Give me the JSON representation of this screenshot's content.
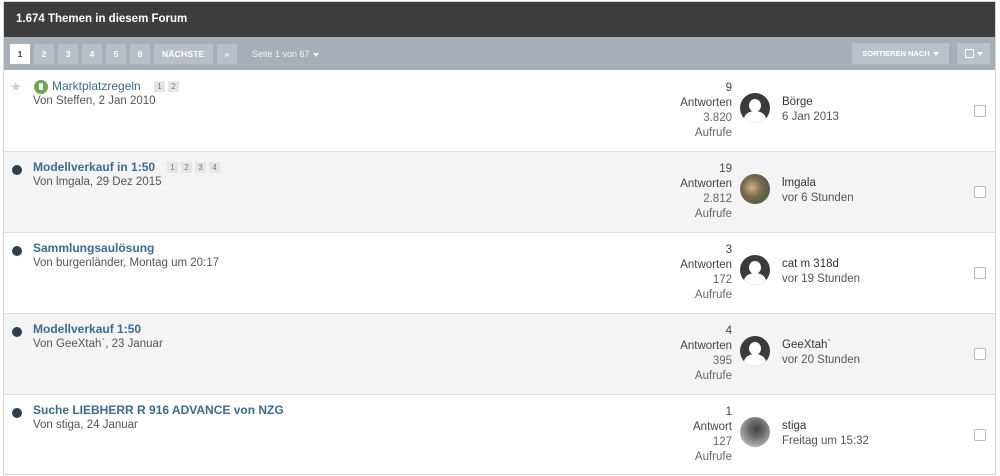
{
  "header": {
    "title": "1.674 Themen in diesem Forum"
  },
  "pager": {
    "pages": [
      "1",
      "2",
      "3",
      "4",
      "5",
      "6"
    ],
    "next_label": "NÄCHSTE",
    "last_label": "»",
    "page_info": "Seite 1 von 67"
  },
  "toolbar": {
    "sort_label": "SORTIEREN NACH"
  },
  "topics": [
    {
      "title": "Marktplatzregeln",
      "pages": [
        "1",
        "2"
      ],
      "starter": "Von Steffen, 2 Jan 2010",
      "replies": "9",
      "replies_label": "Antworten",
      "views": "3.820",
      "views_label": "Aufrufe",
      "last_user": "Börge",
      "last_time": "6 Jan 2013"
    },
    {
      "title": "Modellverkauf in 1:50",
      "pages": [
        "1",
        "2",
        "3",
        "4"
      ],
      "starter": "Von lmgala, 29 Dez 2015",
      "replies": "19",
      "replies_label": "Antworten",
      "views": "2.812",
      "views_label": "Aufrufe",
      "last_user": "lmgala",
      "last_time": "vor 6 Stunden"
    },
    {
      "title": "Sammlungsaulösung",
      "pages": [],
      "starter": "Von burgenländer, Montag um 20:17",
      "replies": "3",
      "replies_label": "Antworten",
      "views": "172",
      "views_label": "Aufrufe",
      "last_user": "cat m 318d",
      "last_time": "vor 19 Stunden"
    },
    {
      "title": "Modellverkauf 1:50",
      "pages": [],
      "starter": "Von GeeXtah`, 23 Januar",
      "replies": "4",
      "replies_label": "Antworten",
      "views": "395",
      "views_label": "Aufrufe",
      "last_user": "GeeXtah`",
      "last_time": "vor 20 Stunden"
    },
    {
      "title": "Suche LIEBHERR R 916 ADVANCE von NZG",
      "pages": [],
      "starter": "Von stiga, 24 Januar",
      "replies": "1",
      "replies_label": "Antwort",
      "views": "127",
      "views_label": "Aufrufe",
      "last_user": "stiga",
      "last_time": "Freitag um 15:32"
    }
  ]
}
